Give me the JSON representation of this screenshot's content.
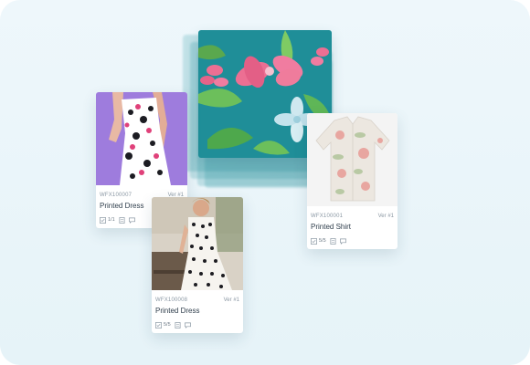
{
  "colors": {
    "background": "#e8f4f9",
    "card": "#ffffff",
    "title_text": "#2e3d4b",
    "meta_text": "#8a97a3",
    "swatch_base": "#1f8e98",
    "flower_pink": "#ec6f93",
    "leaf_green": "#6cbf5b"
  },
  "cards": [
    {
      "sku": "WFX100007",
      "version": "Ver #1",
      "title": "Printed Dress",
      "count": "1/1",
      "image": "floral-dress-photo"
    },
    {
      "sku": "WFX100001",
      "version": "Ver #1",
      "title": "Printed Shirt",
      "count": "5/5",
      "image": "floral-shirt-photo"
    },
    {
      "sku": "WFX100008",
      "version": "Ver #1",
      "title": "Printed Dress",
      "count": "5/5",
      "image": "polka-dress-photo"
    }
  ],
  "card_icons": [
    "checklist-icon",
    "document-icon",
    "comment-icon"
  ],
  "swatch": {
    "image": "floral-fabric-swatch"
  }
}
